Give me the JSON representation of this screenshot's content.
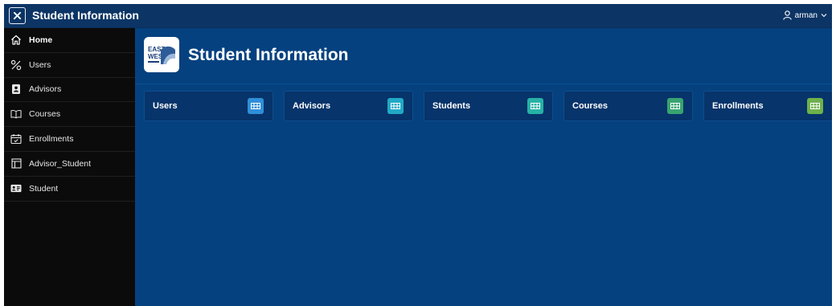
{
  "header": {
    "app_title": "Student Information",
    "user_name": "arman"
  },
  "sidebar": {
    "items": [
      {
        "label": "Home",
        "icon": "home-icon",
        "active": true
      },
      {
        "label": "Users",
        "icon": "percent-icon",
        "active": false
      },
      {
        "label": "Advisors",
        "icon": "contact-book-icon",
        "active": false
      },
      {
        "label": "Courses",
        "icon": "open-book-icon",
        "active": false
      },
      {
        "label": "Enrollments",
        "icon": "calendar-check-icon",
        "active": false
      },
      {
        "label": "Advisor_Student",
        "icon": "layout-panel-icon",
        "active": false
      },
      {
        "label": "Student",
        "icon": "id-card-icon",
        "active": false
      }
    ]
  },
  "page": {
    "title": "Student Information",
    "logo": "east-west-university-logo"
  },
  "cards": [
    {
      "label": "Users",
      "badge_color": "#2f8fd8"
    },
    {
      "label": "Advisors",
      "badge_color": "#21a9c6"
    },
    {
      "label": "Students",
      "badge_color": "#27b2a6"
    },
    {
      "label": "Courses",
      "badge_color": "#38a471"
    },
    {
      "label": "Enrollments",
      "badge_color": "#6fb24c"
    }
  ],
  "colors": {
    "topbar": "#0c3565",
    "sidebar": "#0b0b0b",
    "main": "#05417f",
    "card": "#07346a"
  }
}
